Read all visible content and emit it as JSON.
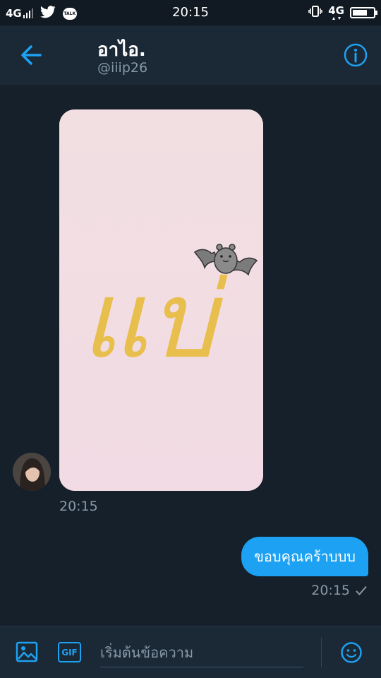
{
  "status_bar": {
    "network_left": "4G",
    "talk_icon_text": "TALK",
    "time": "20:15",
    "network_right": "4G"
  },
  "header": {
    "title": "อาไอ.",
    "handle": "@iiip26",
    "back_icon": "arrow-left-icon",
    "info_icon": "info-circle-icon"
  },
  "conversation": {
    "incoming": {
      "image_text": "แบ่",
      "timestamp": "20:15"
    },
    "outgoing": {
      "text": "ขอบคุณคร้าบบบ",
      "timestamp": "20:15",
      "status_icon": "check-icon"
    }
  },
  "composer": {
    "placeholder": "เริ่มต้นข้อความ",
    "value": "",
    "gif_label": "GIF",
    "photo_icon": "image-icon",
    "emoji_icon": "emoji-icon"
  },
  "colors": {
    "background": "#15202b",
    "header": "#1b2836",
    "accent": "#1da1f2",
    "muted": "#8899a6"
  }
}
